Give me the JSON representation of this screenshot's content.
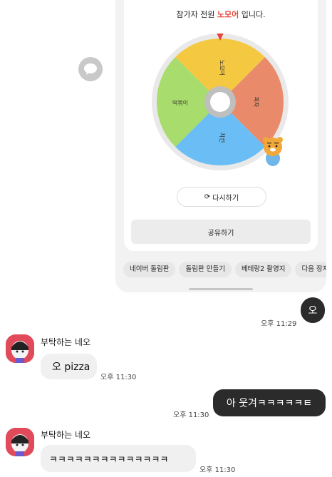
{
  "roulette": {
    "result_prefix": "참가자 전원 ",
    "result_highlight": "노모어",
    "result_suffix": " 입니다.",
    "segments": [
      "노모어",
      "피자",
      "치킨",
      "떡볶이"
    ],
    "segment_colors": [
      "#f5c842",
      "#e98b6b",
      "#6bbef5",
      "#a8dc6c"
    ],
    "pointer_color": "#e3473b",
    "retry_label": "다시하기",
    "share_label": "공유하기"
  },
  "chips": [
    "네이버 돌림판",
    "돌림판 만들기",
    "베테랑2 촬영지",
    "다음 장지"
  ],
  "messages": {
    "me1": {
      "text": "오",
      "time": "오후 11:29"
    },
    "other1": {
      "name": "부탁하는 네오",
      "text": "오 pizza",
      "time": "오후 11:30"
    },
    "me2": {
      "text": "아 웃겨ㅋㅋㅋㅋㅋㅌ",
      "time": "오후 11:30"
    },
    "other2": {
      "name": "부탁하는 네오",
      "text": "ㅋㅋㅋㅋㅋㅋㅋㅋㅋㅋㅋㅋㅋㅋ",
      "time": "오후 11:30"
    }
  }
}
